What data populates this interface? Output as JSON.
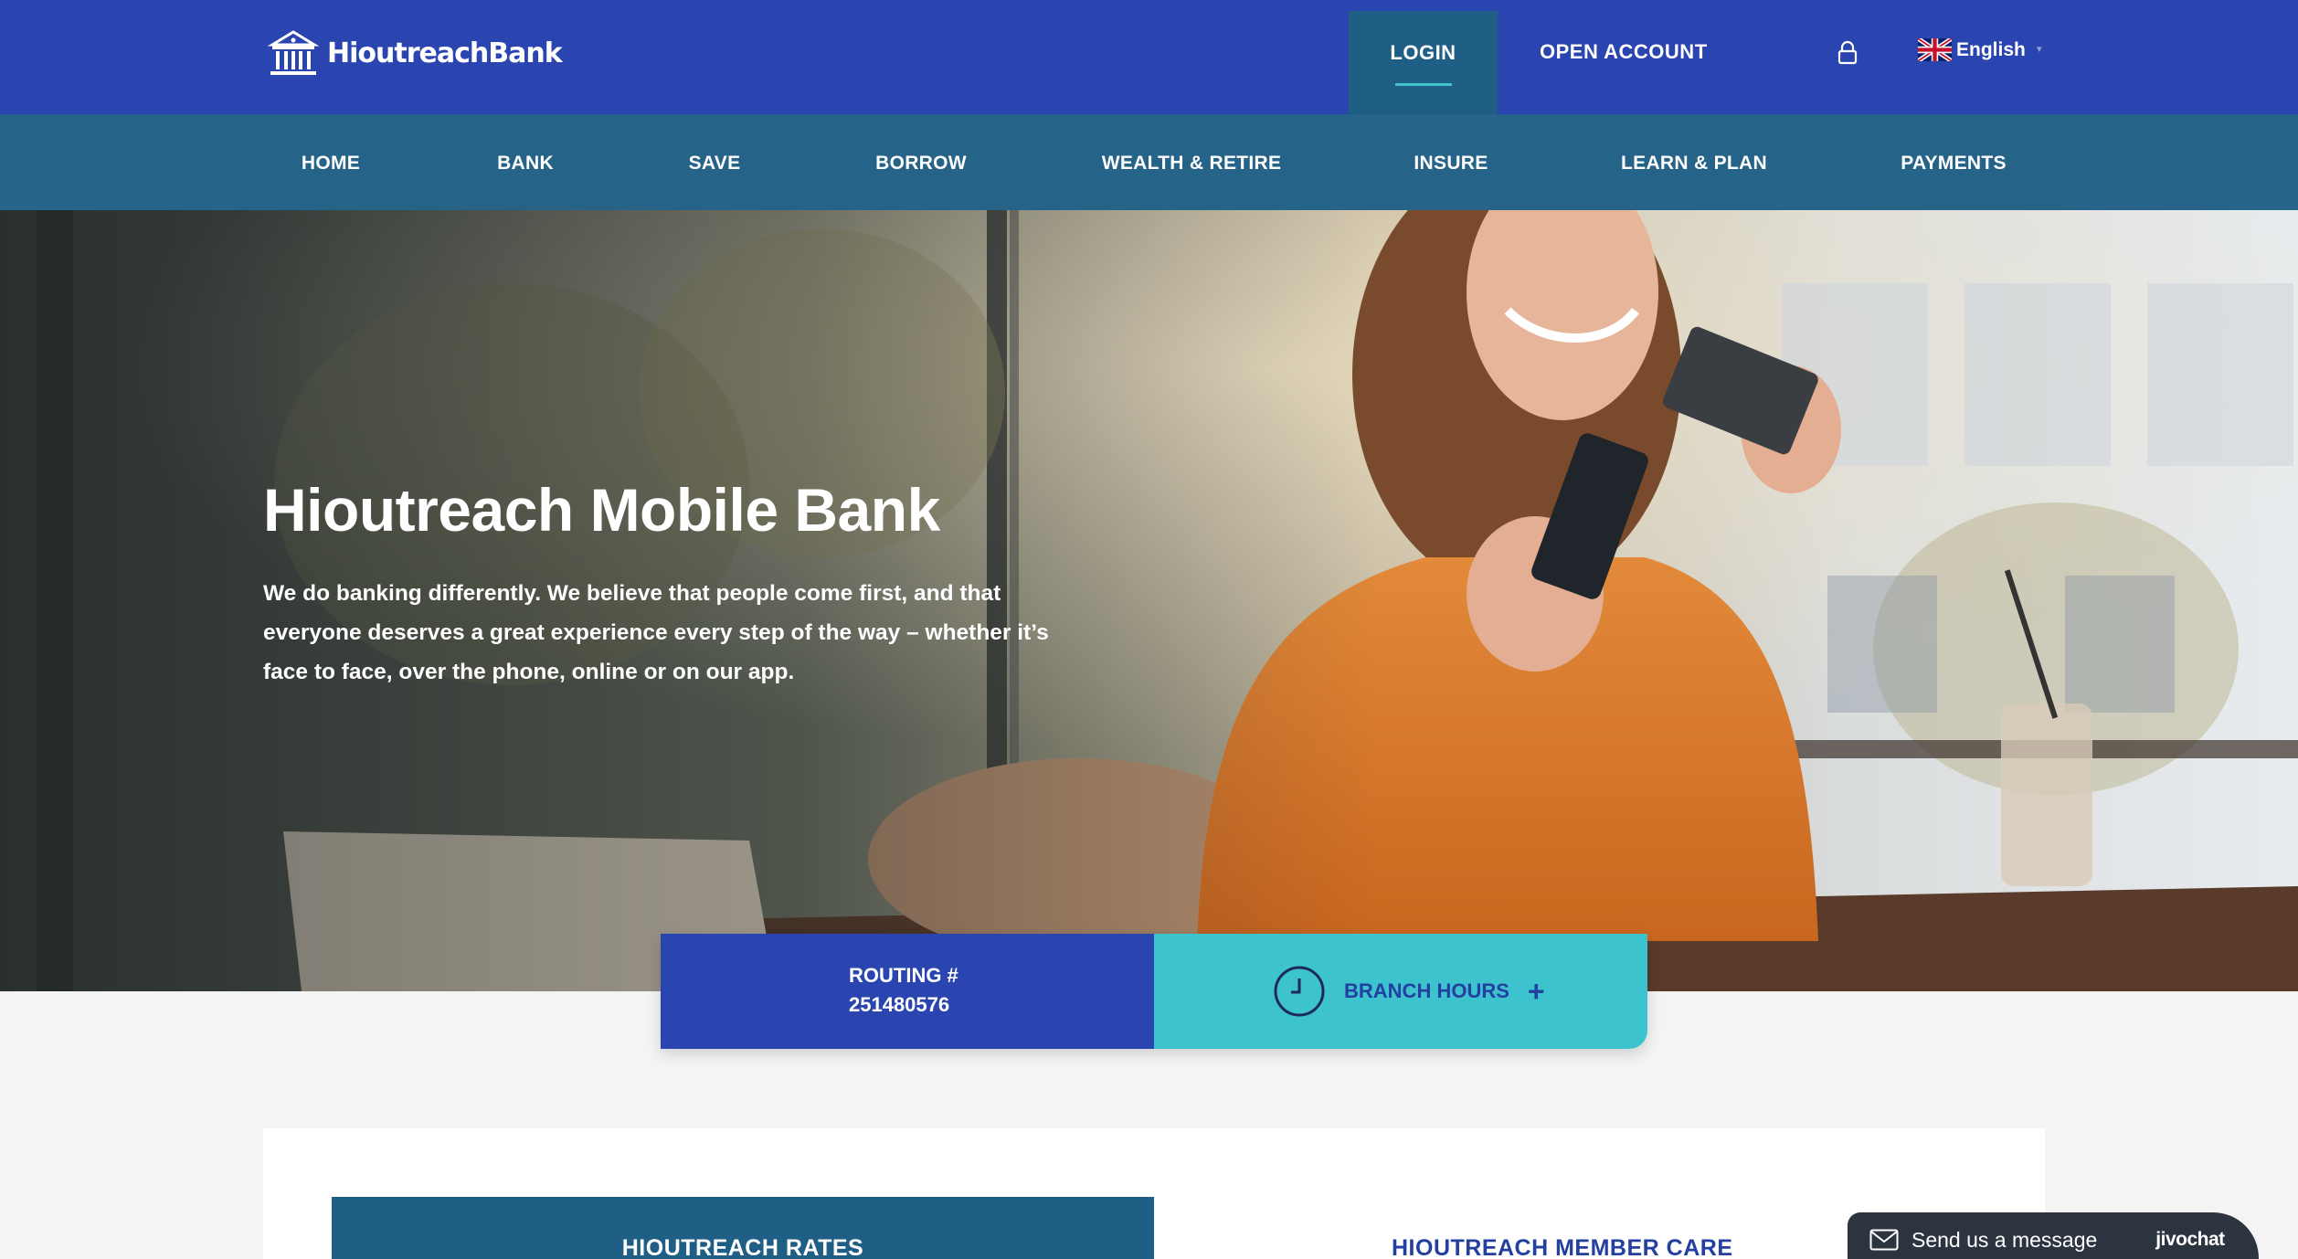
{
  "header": {
    "brand": "HioutreachBank",
    "login_label": "LOGIN",
    "open_account_label": "OPEN ACCOUNT",
    "lock_icon": "lock-icon",
    "language": "English",
    "language_flag": "uk-flag-icon"
  },
  "nav": {
    "items": [
      {
        "label": "HOME"
      },
      {
        "label": "BANK"
      },
      {
        "label": "SAVE"
      },
      {
        "label": "BORROW"
      },
      {
        "label": "WEALTH & RETIRE"
      },
      {
        "label": "INSURE"
      },
      {
        "label": "LEARN & PLAN"
      },
      {
        "label": "PAYMENTS"
      }
    ]
  },
  "hero": {
    "title": "Hioutreach Mobile Bank",
    "text": "We do banking differently. We believe that people come first, and that everyone deserves a great experience every step of the way – whether it’s face to face, over the phone, online or on our app."
  },
  "info_card": {
    "routing_label": "ROUTING #",
    "routing_number": "251480576",
    "branch_hours_label": "BRANCH HOURS",
    "plus": "+"
  },
  "content": {
    "rates_title": "HIOUTREACH RATES",
    "member_care_title": "HIOUTREACH MEMBER CARE"
  },
  "chat": {
    "label": "Send us a message",
    "brand": "jivochat"
  },
  "colors": {
    "header_blue": "#2a44b0",
    "nav_teal": "#1f5f86",
    "accent_cyan": "#3cc3ce",
    "chat_dark": "#2c3440"
  }
}
